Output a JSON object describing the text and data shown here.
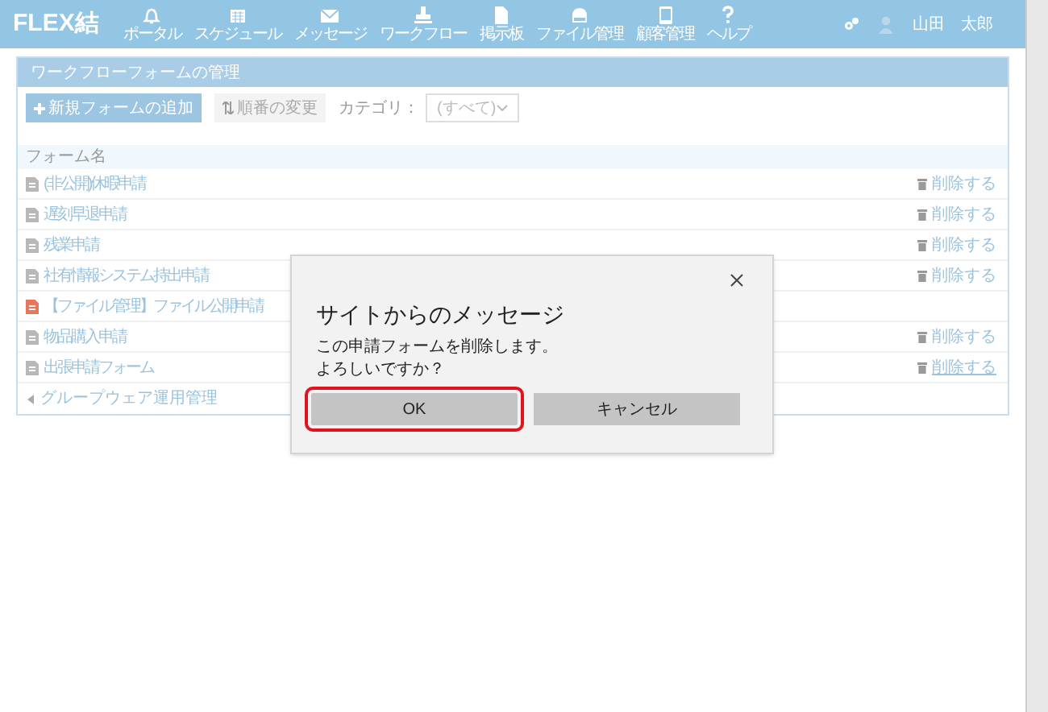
{
  "navbar": {
    "logo": "FLEX結",
    "items": [
      {
        "label": "ポータル"
      },
      {
        "label": "スケジュール"
      },
      {
        "label": "メッセージ"
      },
      {
        "label": "ワークフロー"
      },
      {
        "label": "掲示板"
      },
      {
        "label": "ファイル管理"
      },
      {
        "label": "顧客管理"
      },
      {
        "label": "ヘルプ"
      }
    ],
    "user": "山田　太郎"
  },
  "panel": {
    "title": "ワークフローフォームの管理",
    "toolbar": {
      "add_button": "新規フォームの追加",
      "order_button": "順番の変更",
      "category_label": "カテゴリ：",
      "category_value": "(すべて)"
    },
    "column_header": "フォーム名",
    "rows": [
      {
        "name": "(非公開)休暇申請",
        "color": "#b8b8b8",
        "delete_label": "削除する",
        "hovered": false
      },
      {
        "name": "遅刻早退申請",
        "color": "#b8b8b8",
        "delete_label": "削除する",
        "hovered": false
      },
      {
        "name": "残業申請",
        "color": "#b8b8b8",
        "delete_label": "削除する",
        "hovered": false
      },
      {
        "name": "社有情報システム持出申請",
        "color": "#b8b8b8",
        "delete_label": "削除する",
        "hovered": false
      },
      {
        "name": "【ファイル管理】ファイル公開申請",
        "color": "#e8765a"
      },
      {
        "name": "物品購入申請",
        "color": "#b8b8b8",
        "delete_label": "削除する",
        "hovered": false
      },
      {
        "name": "出張申請フォーム",
        "color": "#b8b8b8",
        "delete_label": "削除する",
        "hovered": true
      }
    ],
    "back_link": "グループウェア運用管理"
  },
  "dialog": {
    "title": "サイトからのメッセージ",
    "message_lines": [
      "この申請フォームを削除します。",
      "よろしいですか？"
    ],
    "buttons": [
      {
        "label": "OK",
        "focused": true
      },
      {
        "label": "キャンセル",
        "focused": false
      }
    ]
  }
}
